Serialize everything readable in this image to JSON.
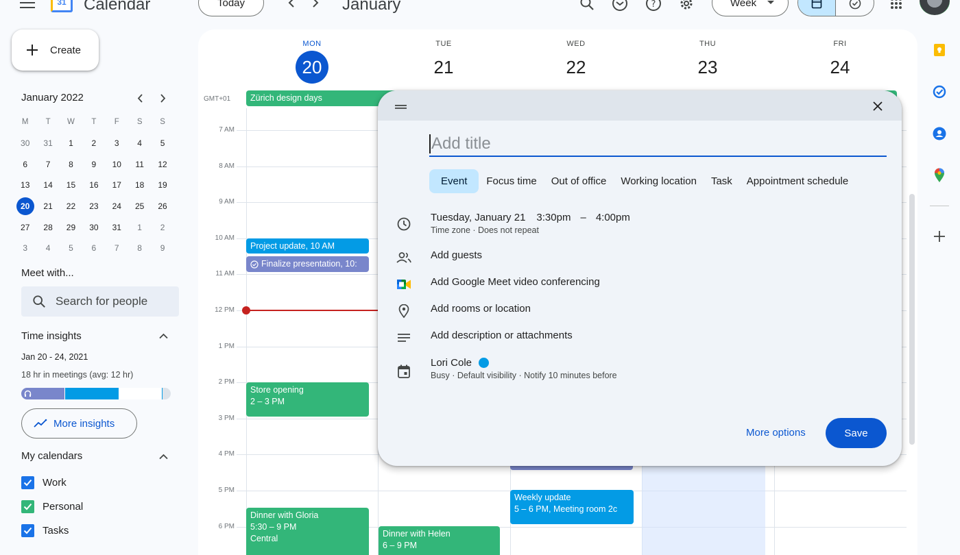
{
  "header": {
    "app_name": "Calendar",
    "logo_number": "31",
    "today_label": "Today",
    "month_label": "January",
    "view_select": "Week"
  },
  "sidebar": {
    "create_label": "Create",
    "mini_calendar": {
      "title": "January 2022",
      "weekday_headers": [
        "M",
        "T",
        "W",
        "T",
        "F",
        "S",
        "S"
      ],
      "weeks": [
        [
          "30",
          "31",
          "1",
          "2",
          "3",
          "4",
          "5"
        ],
        [
          "6",
          "7",
          "8",
          "9",
          "10",
          "11",
          "12"
        ],
        [
          "13",
          "14",
          "15",
          "16",
          "17",
          "18",
          "19"
        ],
        [
          "20",
          "21",
          "22",
          "23",
          "24",
          "25",
          "26"
        ],
        [
          "27",
          "28",
          "29",
          "30",
          "31",
          "1",
          "2"
        ],
        [
          "3",
          "4",
          "5",
          "6",
          "7",
          "8",
          "9"
        ]
      ],
      "selected_day": "20"
    },
    "meet_with": {
      "title": "Meet with...",
      "search_placeholder": "Search for people"
    },
    "time_insights": {
      "title": "Time insights",
      "date_range": "Jan 20 - 24, 2021",
      "summary": "18 hr in meetings (avg: 12 hr)",
      "bar_segments": [
        {
          "fraction": 0.29,
          "color": "#7986cb"
        },
        {
          "fraction": 0.36,
          "color": "#039be5"
        },
        {
          "fraction": 0.29,
          "color": "#ffffff"
        }
      ],
      "more_insights_label": "More insights"
    },
    "my_calendars": {
      "title": "My calendars",
      "items": [
        {
          "label": "Work",
          "color": "#1a73e8",
          "checked": true
        },
        {
          "label": "Personal",
          "color": "#33b679",
          "checked": true
        },
        {
          "label": "Tasks",
          "color": "#1a73e8",
          "checked": true
        }
      ]
    }
  },
  "grid": {
    "timezone": "GMT+01",
    "days": [
      {
        "dow": "MON",
        "num": "20",
        "today": true
      },
      {
        "dow": "TUE",
        "num": "21"
      },
      {
        "dow": "WED",
        "num": "22"
      },
      {
        "dow": "THU",
        "num": "23"
      },
      {
        "dow": "FRI",
        "num": "24"
      }
    ],
    "hours": [
      "7 AM",
      "8 AM",
      "9 AM",
      "10 AM",
      "11 AM",
      "12 PM",
      "1 PM",
      "2 PM",
      "3 PM",
      "4 PM",
      "5 PM",
      "6 PM"
    ],
    "all_day_event": "Zürich design days",
    "events": {
      "project_update": "Project update, 10 AM",
      "finalize": "Finalize presentation, 10:",
      "store_opening_title": "Store opening",
      "store_opening_time": "2 – 3 PM",
      "weekly_update_title": "Weekly update",
      "weekly_update_detail": "5 – 6 PM, Meeting room 2c",
      "dinner_gloria_title": "Dinner with Gloria",
      "dinner_gloria_time": "5:30 – 9 PM",
      "dinner_gloria_location": "Central",
      "dinner_helen_title": "Dinner with Helen",
      "dinner_helen_time": "6 – 9 PM"
    },
    "colors": {
      "green": "#33b679",
      "blue": "#039be5",
      "lavender": "#7986cb",
      "now_line": "#c5221f"
    }
  },
  "dialog": {
    "title_placeholder": "Add title",
    "tabs": [
      "Event",
      "Focus time",
      "Out of office",
      "Working location",
      "Task",
      "Appointment schedule"
    ],
    "date_label": "Tuesday, January 21",
    "start_time": "3:30pm",
    "time_separator": "–",
    "end_time": "4:00pm",
    "time_sub": "Time zone · Does not repeat",
    "add_guests": "Add guests",
    "add_meet": "Add Google Meet video conferencing",
    "add_location": "Add rooms or location",
    "add_description": "Add description or attachments",
    "owner_name": "Lori Cole",
    "owner_sub": "Busy · Default visibility · Notify 10 minutes before",
    "more_options_label": "More options",
    "save_label": "Save"
  }
}
